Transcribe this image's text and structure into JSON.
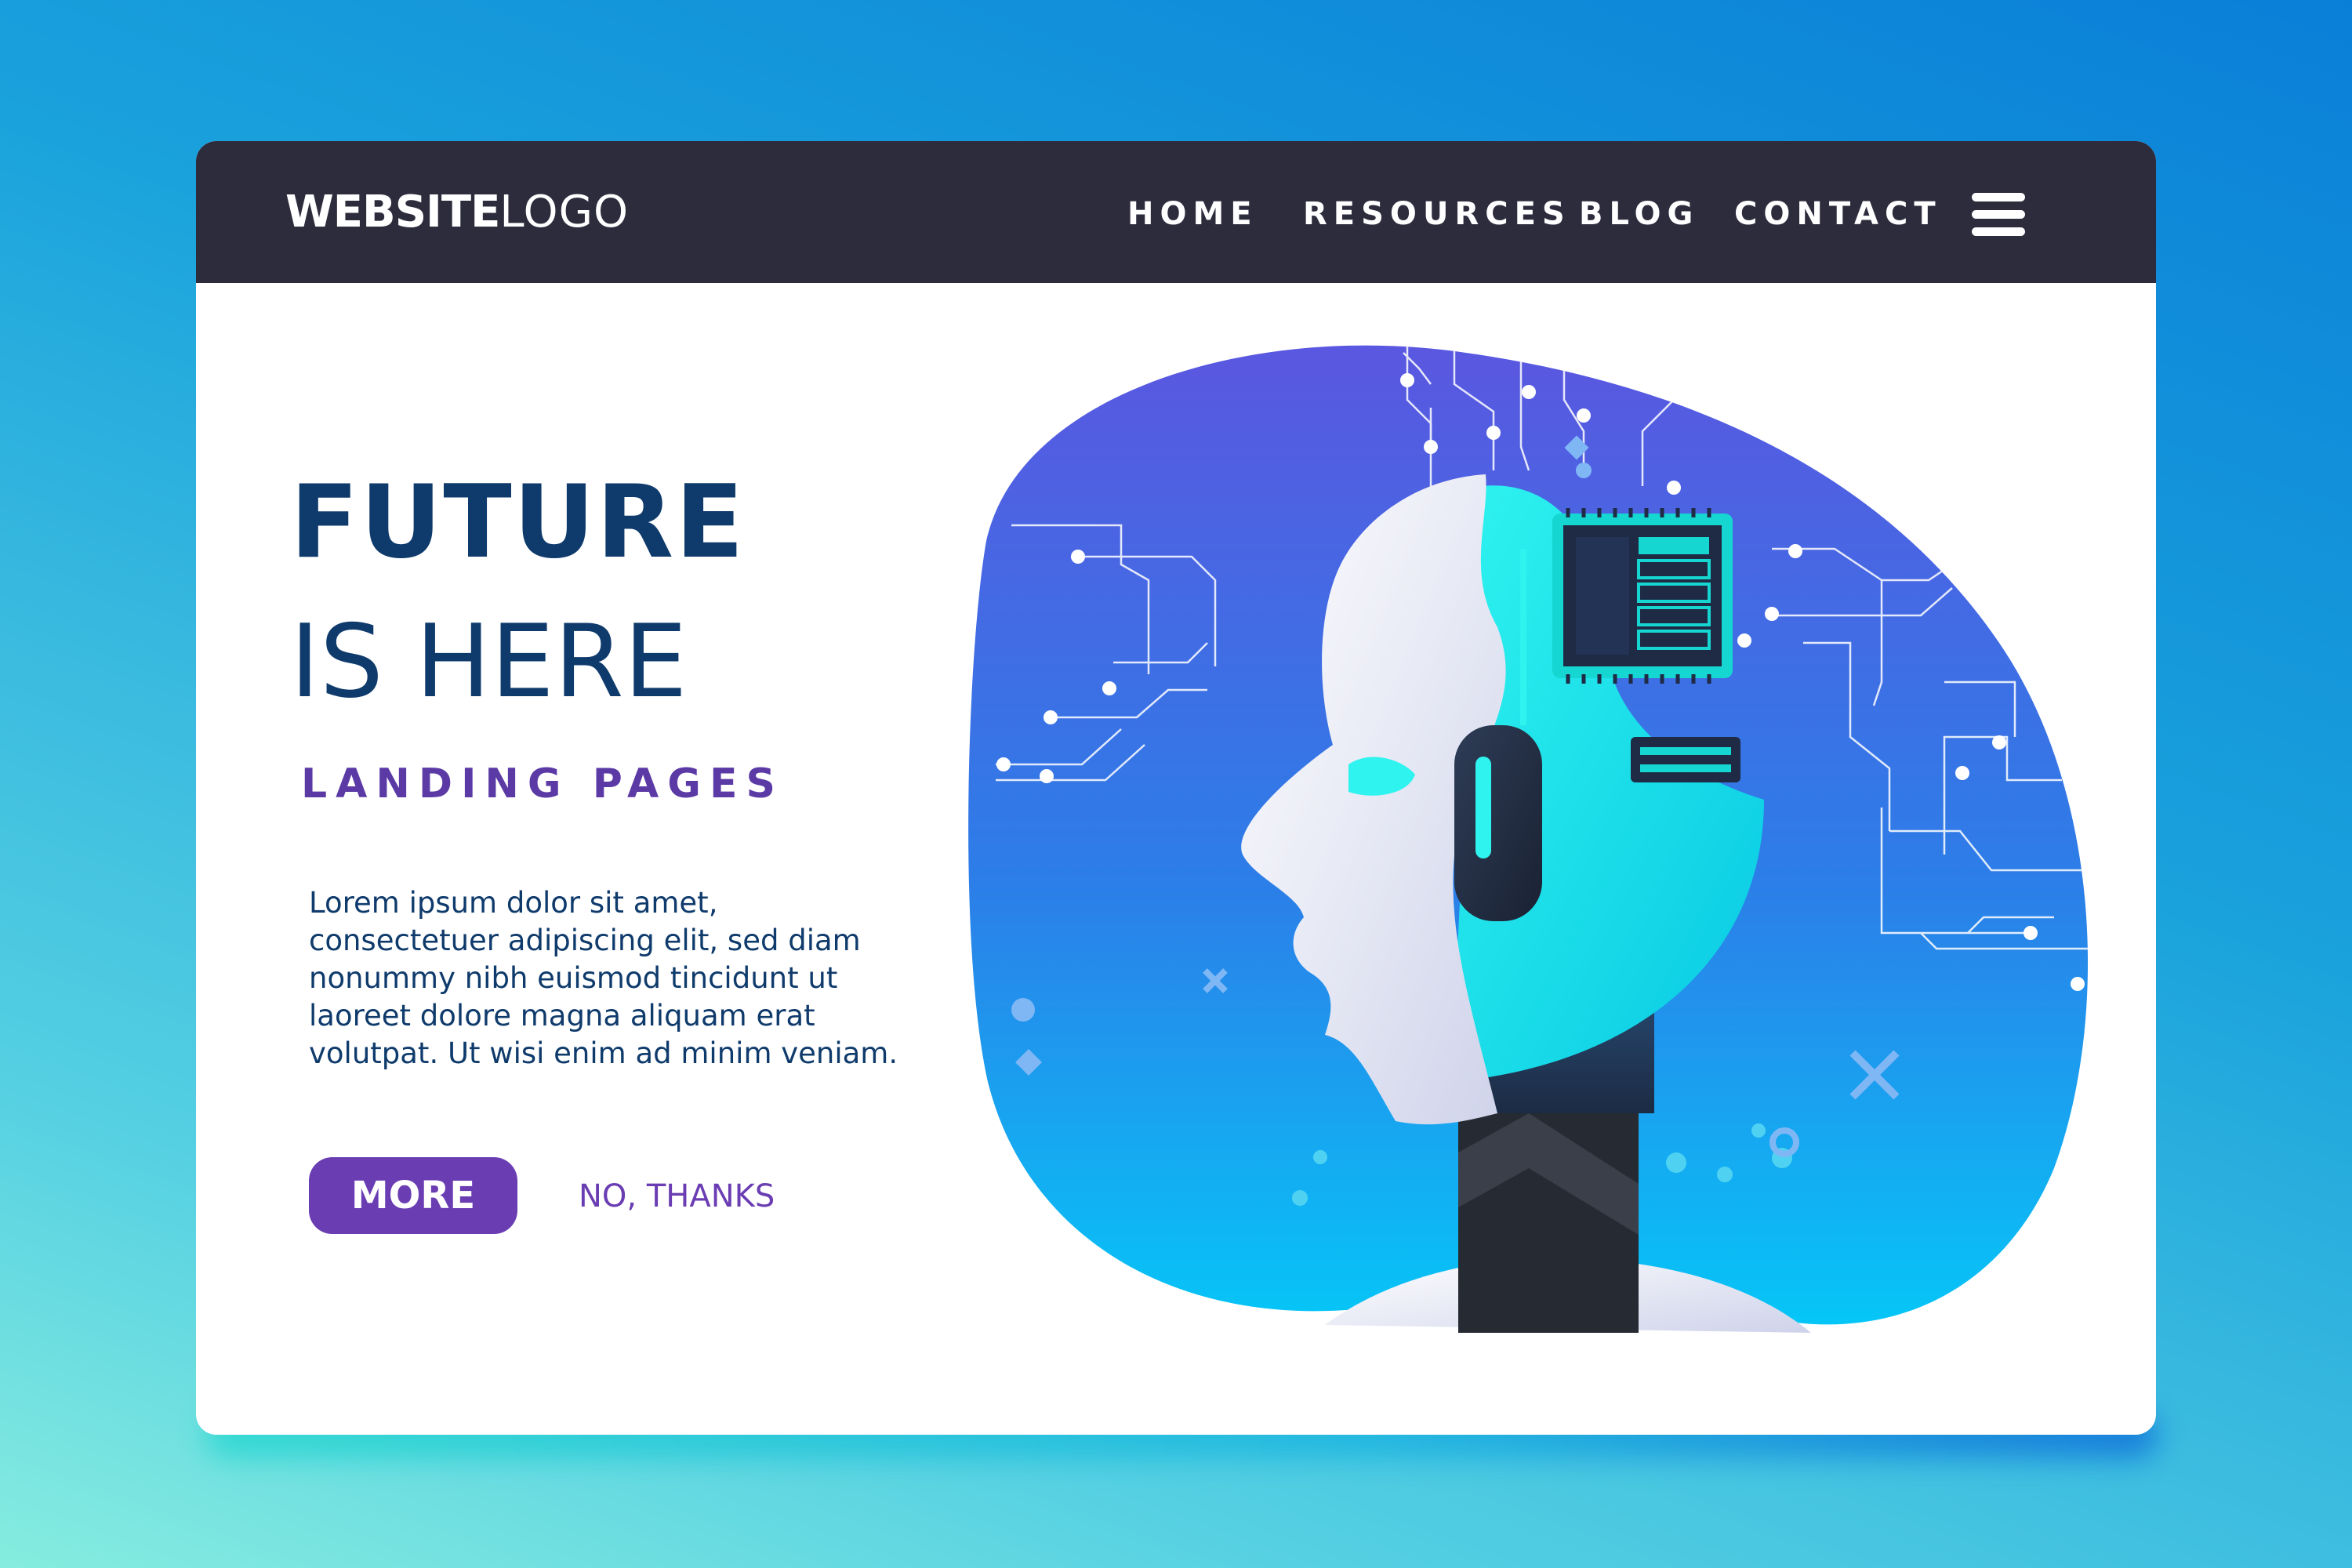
{
  "brand": {
    "logo_bold": "WEBSITE",
    "logo_light": "LOGO"
  },
  "nav": {
    "items": [
      {
        "label": "HOME"
      },
      {
        "label": "RESOURCES"
      },
      {
        "label": "BLOG"
      },
      {
        "label": "CONTACT"
      }
    ],
    "menu_icon": "hamburger-menu-icon"
  },
  "hero": {
    "title_line1": "FUTURE",
    "title_line2": "IS HERE",
    "subtitle": "LANDING PAGES",
    "body_lines": [
      "Lorem ipsum dolor sit amet,",
      "consectetuer adipiscing elit, sed diam",
      "nonummy nibh euismod tincidunt ut",
      "laoreet dolore magna aliquam erat",
      "volutpat. Ut wisi enim ad minim veniam."
    ],
    "primary_button": "MORE",
    "secondary_button": "NO, THANKS",
    "illustration": "robot-head-with-circuit-icon"
  },
  "colors": {
    "navbar": "#2d2c3d",
    "heading": "#0f3b6c",
    "accent_purple": "#6a3db3",
    "blob_top": "#5a57e0",
    "blob_bottom": "#08c3f5",
    "cyan": "#10e6e6"
  }
}
